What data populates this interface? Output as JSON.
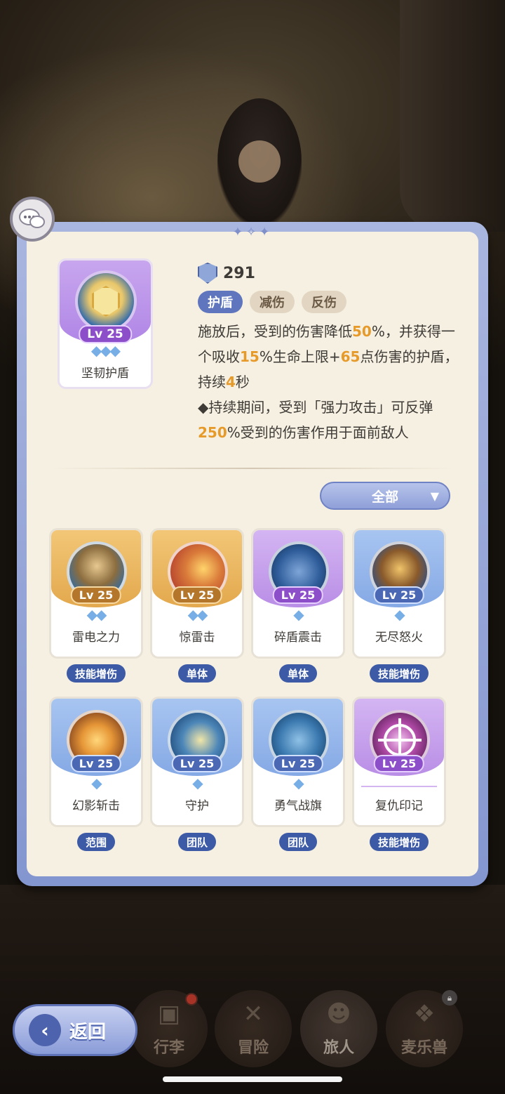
{
  "main_skill": {
    "name": "坚韧护盾",
    "level": "Lv 25",
    "stars": "◆◆◆",
    "cost": "291",
    "tags": [
      "护盾",
      "减伤",
      "反伤"
    ],
    "description": {
      "p1": "施放后，受到的伤害降低",
      "v1": "50",
      "p2": "%，并获得一个吸收",
      "v2": "15",
      "p3": "%生命上限+",
      "v3": "65",
      "p4": "点伤害的护盾，持续",
      "v4": "4",
      "p5": "秒",
      "p6": "◆持续期间，受到「强力攻击」可反弹",
      "v5": "250",
      "p7": "%受到的伤害作用于面前敌人"
    }
  },
  "filter": {
    "label": "全部",
    "arrow": "▼"
  },
  "skills": [
    {
      "name": "雷电之力",
      "level": "Lv 25",
      "stars": "◆◆",
      "tag": "技能增伤",
      "theme": "gold",
      "icon": "thunder-beast-icon"
    },
    {
      "name": "惊雷击",
      "level": "Lv 25",
      "stars": "◆◆",
      "tag": "单体",
      "theme": "gold",
      "icon": "fire-strike-icon"
    },
    {
      "name": "碎盾震击",
      "level": "Lv 25",
      "stars": "◆",
      "tag": "单体",
      "theme": "purple",
      "icon": "shield-shatter-icon"
    },
    {
      "name": "无尽怒火",
      "level": "Lv 25",
      "stars": "◆",
      "tag": "技能增伤",
      "theme": "blue",
      "icon": "rage-fire-icon"
    },
    {
      "name": "幻影斩击",
      "level": "Lv 25",
      "stars": "◆",
      "tag": "范围",
      "theme": "blue",
      "icon": "phantom-slash-icon"
    },
    {
      "name": "守护",
      "level": "Lv 25",
      "stars": "◆",
      "tag": "团队",
      "theme": "blue",
      "icon": "guard-icon"
    },
    {
      "name": "勇气战旗",
      "level": "Lv 25",
      "stars": "◆",
      "tag": "团队",
      "theme": "blue",
      "icon": "banner-icon"
    },
    {
      "name": "复仇印记",
      "level": "Lv 25",
      "stars": "",
      "tag": "技能增伤",
      "theme": "purple",
      "icon": "crosshair-icon"
    }
  ],
  "nav": {
    "back": "返回",
    "items": [
      "行李",
      "冒险",
      "旅人",
      "麦乐兽"
    ]
  },
  "colors": {
    "accent": "#5f76be",
    "highlight": "#e69a2a",
    "panel_border": "#8496cf"
  }
}
